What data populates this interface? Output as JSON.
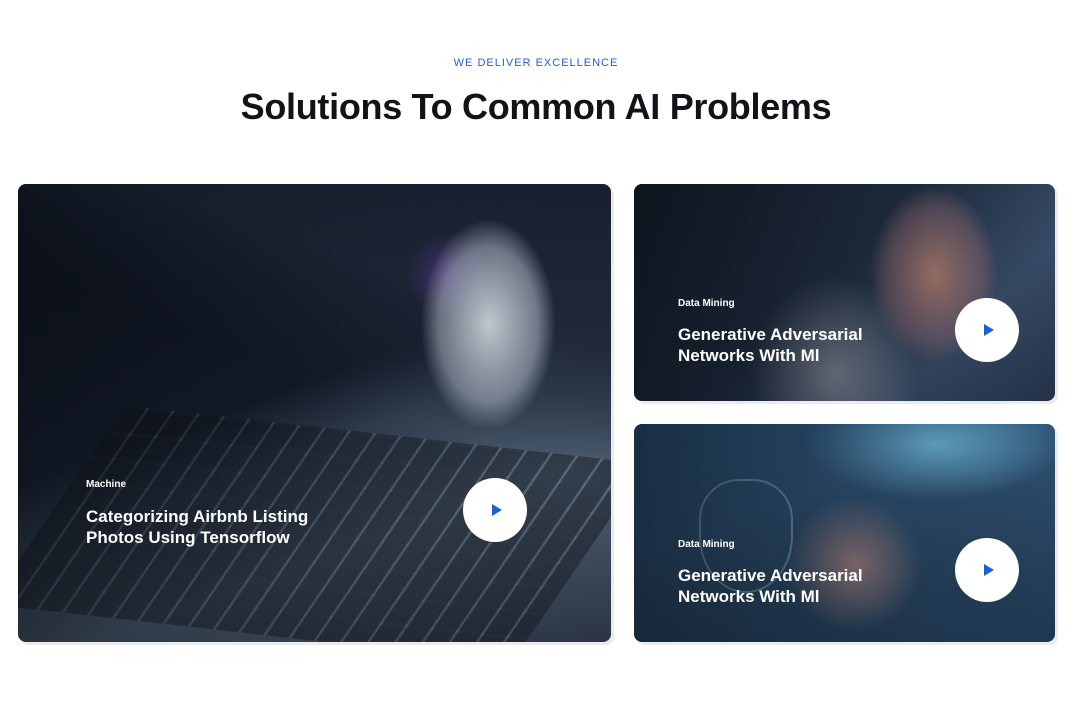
{
  "section": {
    "eyebrow": "WE DELIVER EXCELLENCE",
    "title": "Solutions To Common AI Problems"
  },
  "cards": [
    {
      "category": "Machine",
      "title_line1": "Categorizing Airbnb Listing",
      "title_line2": "Photos Using Tensorflow",
      "play_icon": "play-icon"
    },
    {
      "category": "Data Mining",
      "title_line1": "Generative Adversarial",
      "title_line2": "Networks With Ml",
      "play_icon": "play-icon"
    },
    {
      "category": "Data Mining",
      "title_line1": "Generative Adversarial",
      "title_line2": "Networks With Ml",
      "play_icon": "play-icon"
    }
  ],
  "colors": {
    "accent": "#1f5fd6",
    "heading": "#111318",
    "play_button_bg": "#ffffff"
  }
}
